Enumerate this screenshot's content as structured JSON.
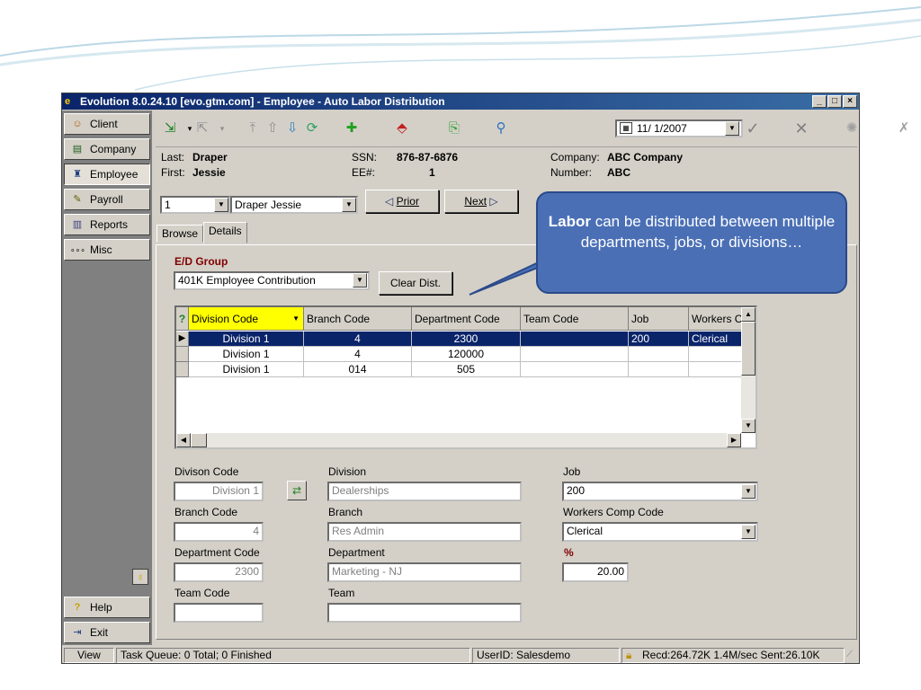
{
  "window": {
    "title": "Evolution 8.0.24.10 [evo.gtm.com] - Employee - Auto Labor Distribution",
    "controls": [
      "_",
      "□",
      "×"
    ]
  },
  "sidebar": {
    "items": [
      {
        "label": "Client",
        "icon": "client-icon",
        "glyph": "☺"
      },
      {
        "label": "Company",
        "icon": "company-icon",
        "glyph": "▤"
      },
      {
        "label": "Employee",
        "icon": "employee-icon",
        "glyph": "♜"
      },
      {
        "label": "Payroll",
        "icon": "payroll-icon",
        "glyph": "✎"
      },
      {
        "label": "Reports",
        "icon": "reports-icon",
        "glyph": "▥"
      },
      {
        "label": "Misc",
        "icon": "misc-icon",
        "glyph": "∘∘∘"
      }
    ],
    "help": "Help",
    "exit": "Exit"
  },
  "toolbar": {
    "date": "11/ 1/2007"
  },
  "employee": {
    "last_label": "Last:",
    "last": "Draper",
    "first_label": "First:",
    "first": "Jessie",
    "ssn_label": "SSN:",
    "ssn": "876-87-6876",
    "ee_label": "EE#:",
    "ee": "1",
    "company_label": "Company:",
    "company": "ABC Company",
    "number_label": "Number:",
    "number": "ABC"
  },
  "navrow": {
    "ee_select": "1",
    "name_select": "Draper Jessie",
    "prior": "Prior",
    "next": "Next"
  },
  "tabs": [
    "Browse",
    "Details"
  ],
  "ed_group": {
    "label": "E/D Group",
    "value": "401K Employee Contribution",
    "clear_button": "Clear Dist."
  },
  "grid": {
    "columns": [
      "Division Code",
      "Branch Code",
      "Department Code",
      "Team Code",
      "Job",
      "Workers C"
    ],
    "rows": [
      [
        "Division 1",
        "4",
        "2300",
        "",
        "200",
        "Clerical"
      ],
      [
        "Division 1",
        "4",
        "120000",
        "",
        "",
        ""
      ],
      [
        "Division 1",
        "014",
        "505",
        "",
        "",
        ""
      ]
    ]
  },
  "detail": {
    "division_code_label": "Divison Code",
    "division_code": "Division 1",
    "division_label": "Division",
    "division": "Dealerships",
    "branch_code_label": "Branch Code",
    "branch_code": "4",
    "branch_label": "Branch",
    "branch": "Res Admin",
    "department_code_label": "Department Code",
    "department_code": "2300",
    "department_label": "Department",
    "department": "Marketing - NJ",
    "team_code_label": "Team Code",
    "team_code": "",
    "team_label": "Team",
    "team": "",
    "job_label": "Job",
    "job": "200",
    "workers_comp_label": "Workers Comp Code",
    "workers_comp": "Clerical",
    "percent_label": "%",
    "percent": "20.00"
  },
  "statusbar": {
    "view": "View",
    "queue": "Task Queue: 0 Total; 0 Finished",
    "user": "UserID: Salesdemo",
    "traffic": "Recd:264.72K  1.4M/sec  Sent:26.10K"
  },
  "callout": {
    "bold": "Labor",
    "text": " can be distributed between multiple departments, jobs, or divisions…"
  },
  "colors": {
    "title_bar": "#0a246a",
    "selection": "#0a246a",
    "callout": "#4a6fb5",
    "header_highlight": "#ffff00",
    "ed_label": "#800000"
  }
}
